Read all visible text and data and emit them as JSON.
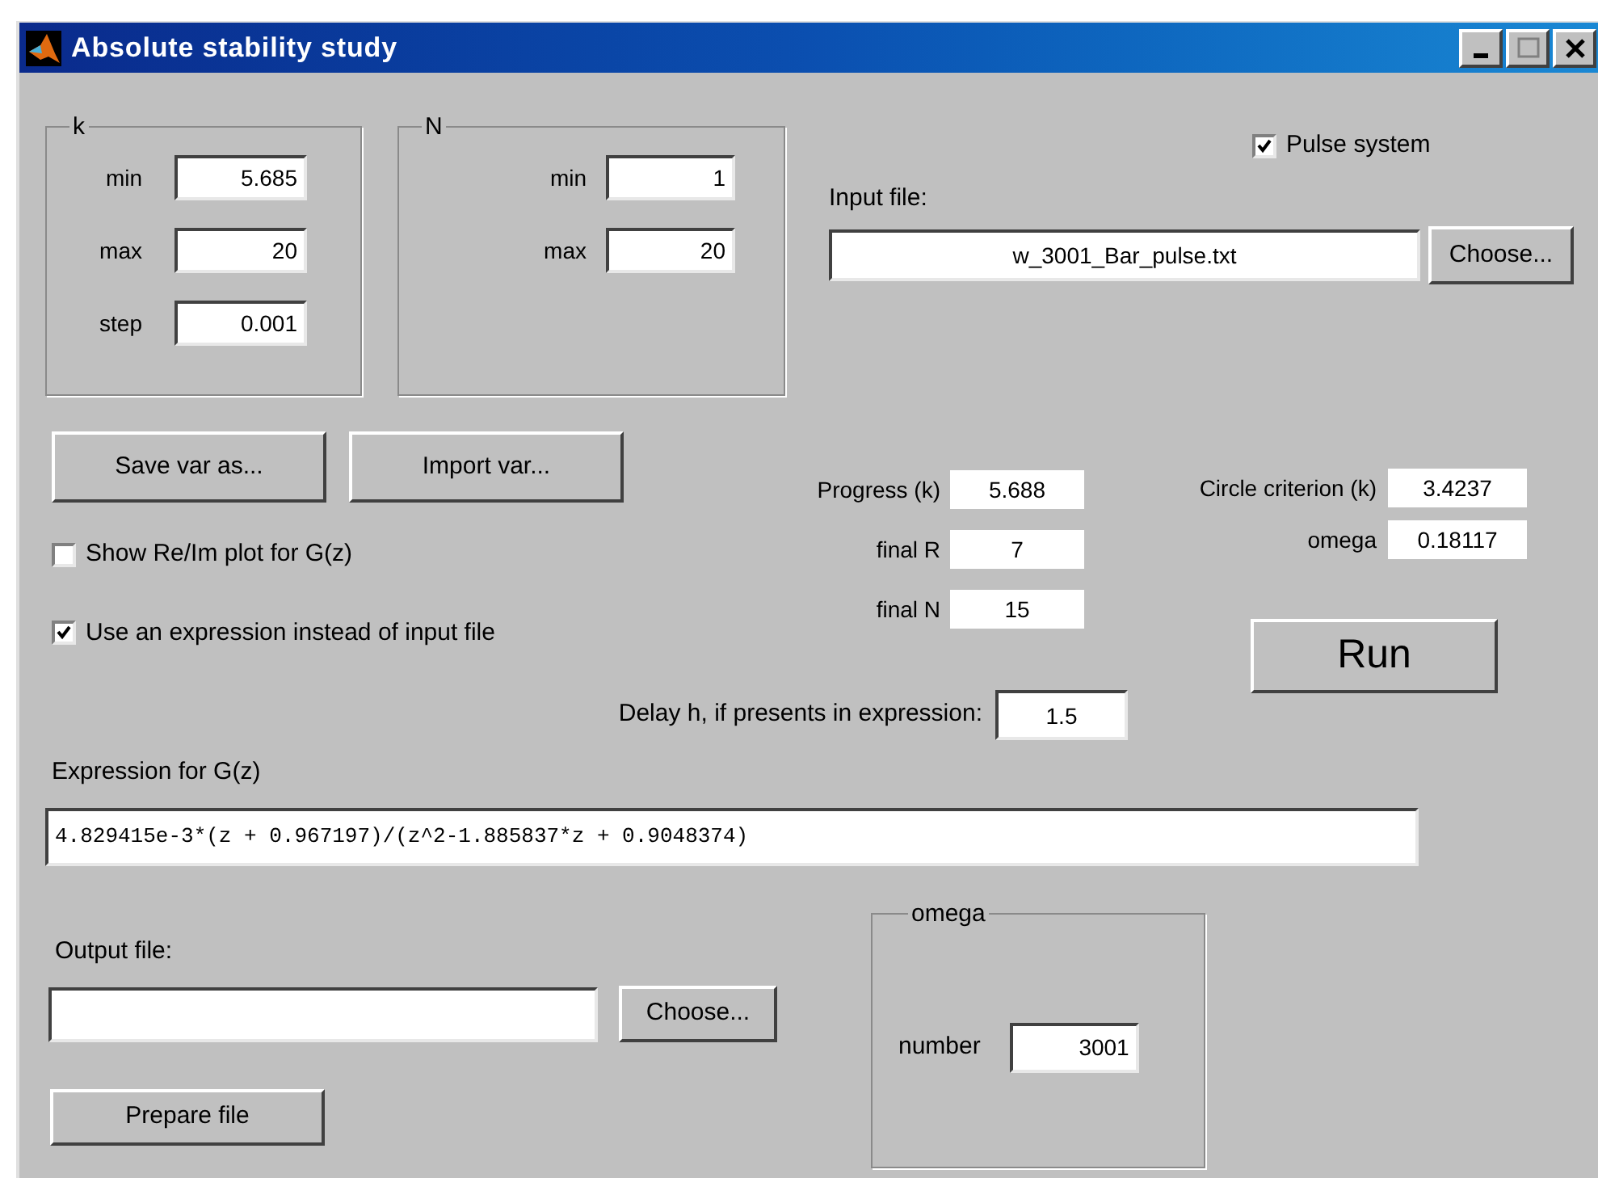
{
  "window": {
    "title": "Absolute stability study"
  },
  "k_group": {
    "label": "k",
    "fields": [
      {
        "label": "min",
        "value": "5.685"
      },
      {
        "label": "max",
        "value": "20"
      },
      {
        "label": "step",
        "value": "0.001"
      }
    ]
  },
  "n_group": {
    "label": "N",
    "fields": [
      {
        "label": "min",
        "value": "1"
      },
      {
        "label": "max",
        "value": "20"
      }
    ]
  },
  "pulse_system": {
    "label": "Pulse system",
    "checked": true
  },
  "input_file": {
    "label": "Input file:",
    "value": "w_3001_Bar_pulse.txt",
    "button": "Choose..."
  },
  "var_buttons": [
    "Save var as...",
    "Import var..."
  ],
  "options": [
    {
      "label": "Show Re/Im plot for G(z)",
      "checked": false
    },
    {
      "label": "Use an expression instead of input file",
      "checked": true
    }
  ],
  "results": [
    {
      "label": "Progress (k)",
      "value": "5.688"
    },
    {
      "label": "final R",
      "value": "7"
    },
    {
      "label": "final N",
      "value": "15"
    }
  ],
  "circle": [
    {
      "label": "Circle criterion (k)",
      "value": "3.4237"
    },
    {
      "label": "omega",
      "value": "0.18117"
    }
  ],
  "run_button": "Run",
  "delay": {
    "label": "Delay h, if presents in expression:",
    "value": "1.5"
  },
  "expression": {
    "label": "Expression for G(z)",
    "value": "4.829415e-3*(z + 0.967197)/(z^2-1.885837*z + 0.9048374)"
  },
  "output_file": {
    "label": "Output file:",
    "button": "Choose..."
  },
  "prepare_button": "Prepare file",
  "omega_group": {
    "label": "omega",
    "field_label": "number",
    "value": "3001"
  }
}
